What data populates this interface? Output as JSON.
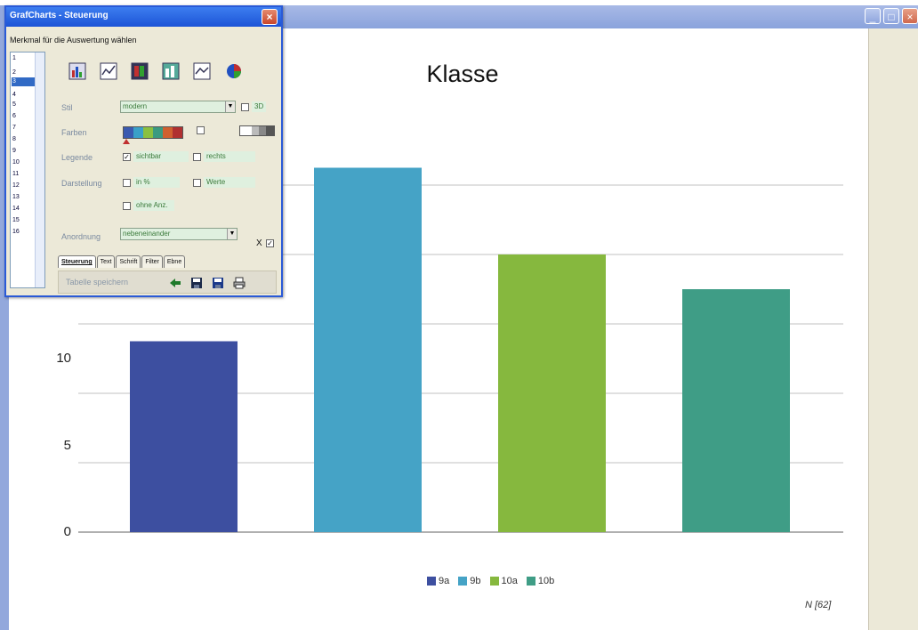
{
  "window": {
    "minimize_label": "_",
    "maximize_label": "□",
    "close_label": "×"
  },
  "dialog": {
    "title": "GrafCharts - Steuerung",
    "close_label": "×",
    "subtitle": "Merkmal für die Auswertung wählen",
    "list_items": [
      "1",
      "2",
      "3",
      "4",
      "5",
      "6",
      "7",
      "8",
      "9",
      "10",
      "11",
      "12",
      "13",
      "14",
      "15",
      "16"
    ],
    "list_selected": "3",
    "toolbar_icons": [
      "bar-chart-icon",
      "line-chart-icon",
      "stacked-bar-icon",
      "3d-bar-icon",
      "area-chart-icon",
      "pie-chart-icon"
    ],
    "stil_label": "Stil",
    "stil_value": "modern",
    "threed_label": "3D",
    "farben_label": "Farben",
    "palette_colors": [
      "#3a5ab0",
      "#3aa0c8",
      "#8ac040",
      "#3a9a80",
      "#d06030",
      "#b03030"
    ],
    "legende_label": "Legende",
    "legende_option_1": "sichtbar",
    "legende_option_2": "rechts",
    "darstellung_label": "Darstellung",
    "darstellung_option_1": "in %",
    "darstellung_option_2": "Werte",
    "darstellung_option_3": "ohne Anz.",
    "anordnung_label": "Anordnung",
    "anordnung_value": "nebeneinander",
    "x_label": "X",
    "tabs": [
      "Steuerung",
      "Text",
      "Schrift",
      "Filter",
      "Ebne"
    ],
    "save_label": "Tabelle speichern"
  },
  "chart_data": {
    "type": "bar",
    "title": "Klasse",
    "categories": [
      "9a",
      "9b",
      "10a",
      "10b"
    ],
    "values": [
      11,
      21,
      16,
      14
    ],
    "colors": [
      "#3d4fa0",
      "#45a3c6",
      "#86b83e",
      "#3f9d86"
    ],
    "ylim": [
      0,
      22
    ],
    "yticks": [
      0,
      5,
      10
    ],
    "grid": true,
    "legend_position": "bottom",
    "n_label": "N [62]"
  }
}
